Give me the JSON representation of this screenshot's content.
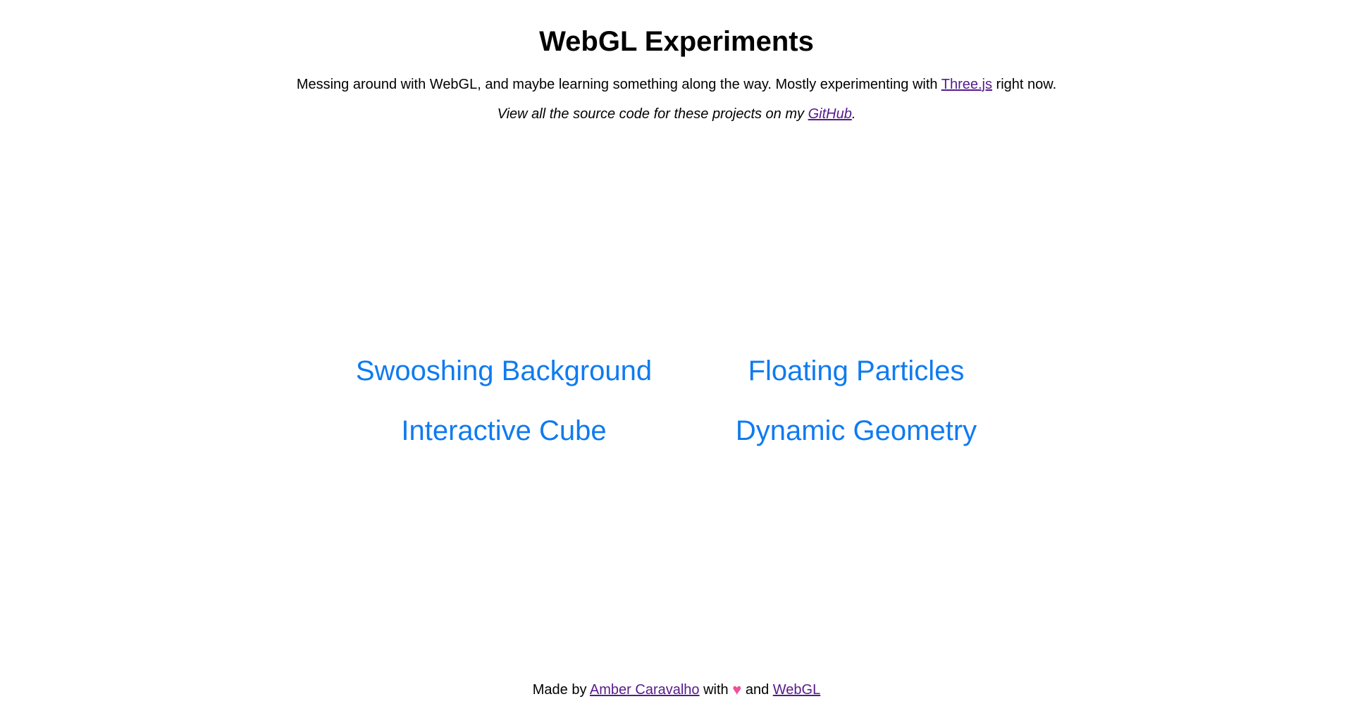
{
  "header": {
    "title": "WebGL Experiments",
    "intro_text": "Messing around with WebGL, and maybe learning something along the way. Mostly experimenting with ",
    "intro_link": "Three.js",
    "intro_suffix": " right now.",
    "source_prefix": "View all the source code for these projects on my ",
    "source_link": "GitHub",
    "source_suffix": "."
  },
  "experiments": [
    {
      "label": "Swooshing Background"
    },
    {
      "label": "Floating Particles"
    },
    {
      "label": "Interactive Cube"
    },
    {
      "label": "Dynamic Geometry"
    }
  ],
  "footer": {
    "prefix": "Made by ",
    "author_link": "Amber Caravalho",
    "middle": " with ",
    "heart_icon": "heart-icon",
    "and_text": " and ",
    "webgl_link": "WebGL"
  },
  "colors": {
    "experiment_link": "#0f7bf0",
    "visited_link": "#551a8b",
    "heart": "#f0509a"
  }
}
